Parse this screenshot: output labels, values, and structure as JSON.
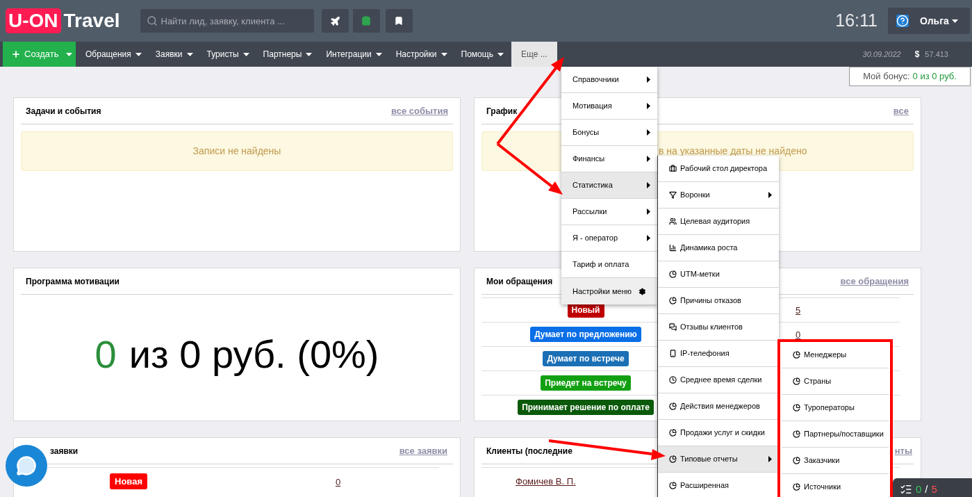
{
  "header": {
    "logo": {
      "badge": "U-ON",
      "word": "Travel"
    },
    "search": {
      "placeholder": "Найти лид, заявку, клиента ..."
    },
    "time": "16:11",
    "user": "Ольга"
  },
  "nav": {
    "create": "Создать",
    "items": [
      {
        "label": "Обращения",
        "selected": false
      },
      {
        "label": "Заявки",
        "selected": false
      },
      {
        "label": "Туристы",
        "selected": false
      },
      {
        "label": "Партнеры",
        "selected": false
      },
      {
        "label": "Интеграции",
        "selected": false
      },
      {
        "label": "Настройки",
        "selected": false
      },
      {
        "label": "Помощь",
        "selected": false
      },
      {
        "label": "Еще ...",
        "selected": true
      }
    ],
    "date": "30.09.2022",
    "currency": "$",
    "rate": "57.413"
  },
  "bonus": {
    "label": "Мой бонус:",
    "value": "0 из 0 руб."
  },
  "tasks_card": {
    "title": "Задачи и события",
    "link": "все события",
    "notice": "Записи не найдены"
  },
  "schedule_card": {
    "title": "График",
    "link": "все",
    "notice": "в на указанные даты не найдено"
  },
  "motivation_card": {
    "title": "Программа мотивации",
    "achieved": "0",
    "rest": "из 0 руб. (0%)"
  },
  "appeals_card": {
    "title": "Мои обращения",
    "link": "все обращения",
    "rows": [
      {
        "status": "Новый",
        "color": "#c00000",
        "count": "5"
      },
      {
        "status": "Думает по предложению",
        "color": "#0a6ee6",
        "count": "0"
      },
      {
        "status": "Думает по встрече",
        "color": "#1a6fb5"
      },
      {
        "status": "Приедет на встречу",
        "color": "#12a012"
      },
      {
        "status": "Принимает решение по оплате",
        "color": "#0b5a0b"
      }
    ]
  },
  "orders_card": {
    "title": "заявки",
    "link": "все заявки",
    "rows": [
      {
        "status": "Новая",
        "color": "#ff0000",
        "count": "0"
      }
    ]
  },
  "clients_card": {
    "title": "Клиенты (последние",
    "link": "нты",
    "rows": [
      {
        "name": "Фомичев В. П."
      }
    ]
  },
  "more_menu": {
    "items": [
      {
        "label": "Справочники",
        "submenu": true,
        "selected": false
      },
      {
        "label": "Мотивация",
        "submenu": true,
        "selected": false
      },
      {
        "label": "Бонусы",
        "submenu": true,
        "selected": false
      },
      {
        "label": "Финансы",
        "submenu": true,
        "selected": false
      },
      {
        "label": "Статистика",
        "submenu": true,
        "selected": true
      },
      {
        "label": "Рассылки",
        "submenu": true,
        "selected": false
      },
      {
        "label": "Я - оператор",
        "submenu": true,
        "selected": false
      },
      {
        "label": "Тариф и оплата",
        "submenu": false,
        "selected": false
      }
    ],
    "footer": "Настройки меню"
  },
  "statistics_menu": {
    "items": [
      {
        "label": "Рабочий стол директора",
        "submenu": false,
        "selected": false
      },
      {
        "label": "Воронки",
        "submenu": true,
        "selected": false
      },
      {
        "label": "Целевая аудитория",
        "submenu": false,
        "selected": false
      },
      {
        "label": "Динамика роста",
        "submenu": false,
        "selected": false
      },
      {
        "label": "UTM-метки",
        "submenu": false,
        "selected": false
      },
      {
        "label": "Причины отказов",
        "submenu": false,
        "selected": false
      },
      {
        "label": "Отзывы клиентов",
        "submenu": false,
        "selected": false
      },
      {
        "label": "IP-телефония",
        "submenu": false,
        "selected": false
      },
      {
        "label": "Среднее время сделки",
        "submenu": false,
        "selected": false
      },
      {
        "label": "Действия менеджеров",
        "submenu": false,
        "selected": false
      },
      {
        "label": "Продажи услуг и скидки",
        "submenu": false,
        "selected": false
      },
      {
        "label": "Типовые отчеты",
        "submenu": true,
        "selected": true
      },
      {
        "label": "Расширенная",
        "submenu": false,
        "selected": false
      }
    ]
  },
  "reports_menu": {
    "items": [
      {
        "label": "Менеджеры"
      },
      {
        "label": "Страны"
      },
      {
        "label": "Туроператоры"
      },
      {
        "label": "Партнеры/поставщики"
      },
      {
        "label": "Заказчики"
      },
      {
        "label": "Источники"
      }
    ]
  },
  "task_counter": {
    "done": "0",
    "separator": "/",
    "total": "5"
  }
}
